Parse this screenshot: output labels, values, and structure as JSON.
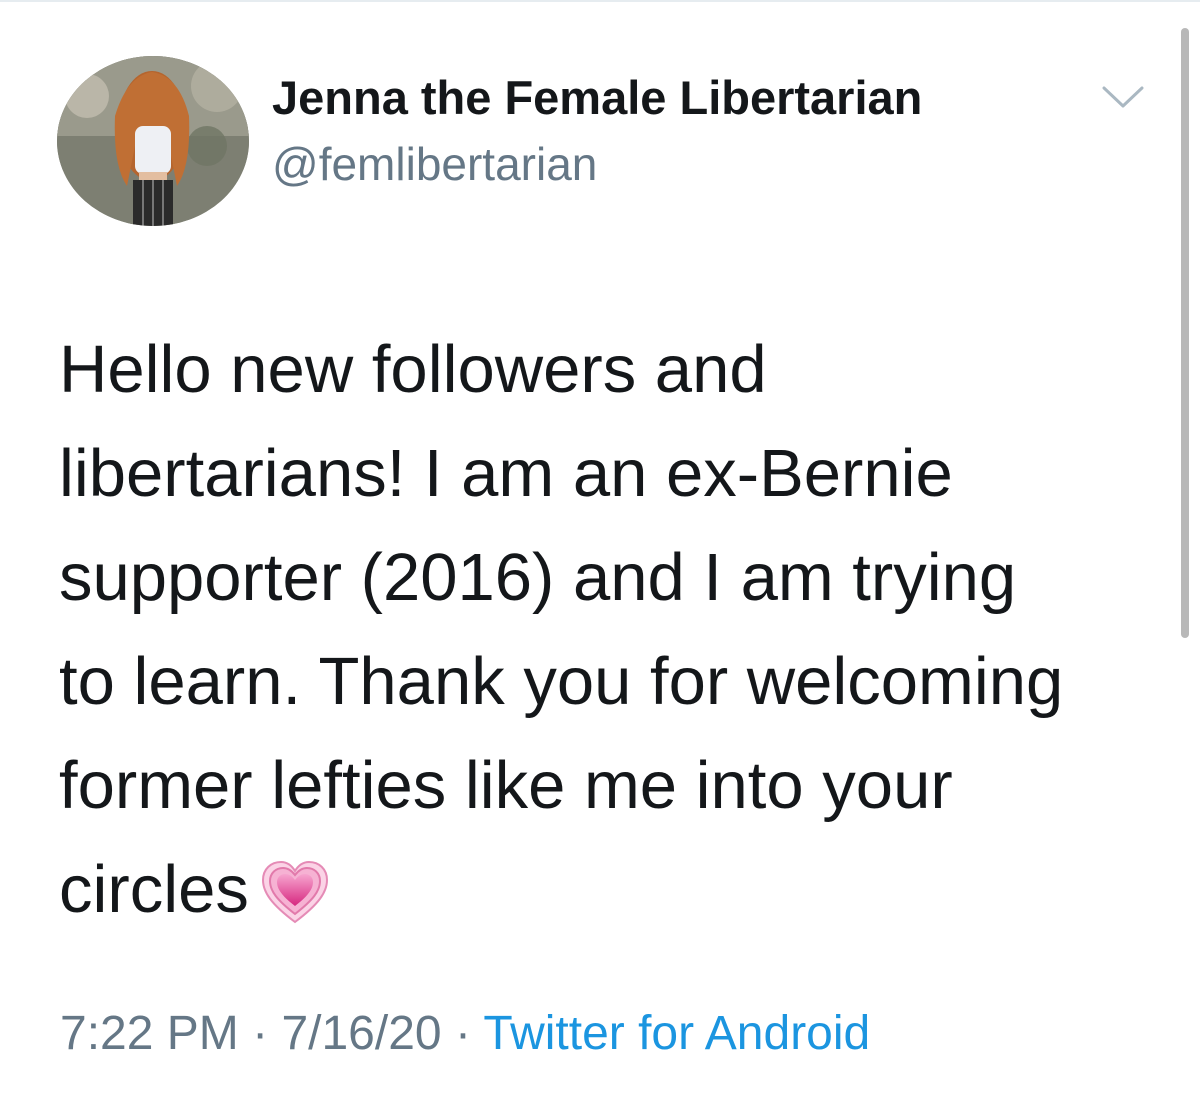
{
  "tweet": {
    "author": {
      "display_name": "Jenna the Female Libertarian",
      "handle": "@femlibertarian"
    },
    "text_lines": [
      "Hello new followers and",
      "libertarians! I am an ex-Bernie",
      "supporter (2016) and I am trying",
      "to learn. Thank you for welcoming",
      "former lefties like me into your",
      "circles"
    ],
    "emoji": "growing-heart-emoji",
    "meta": {
      "time": "7:22 PM",
      "separator": "·",
      "date": "7/16/20",
      "source": "Twitter for Android"
    }
  },
  "icons": {
    "caret": "chevron-down-icon"
  },
  "colors": {
    "text": "#14171a",
    "secondary": "#657786",
    "link": "#1b95e0"
  }
}
